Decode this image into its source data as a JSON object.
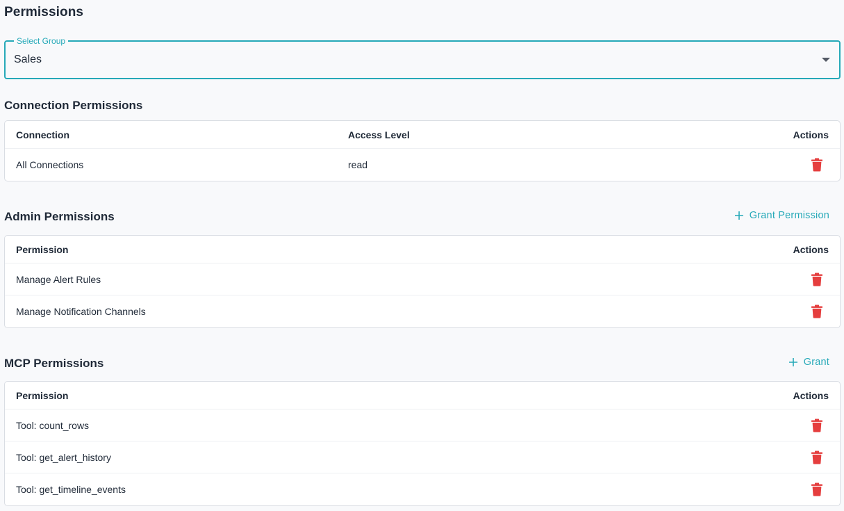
{
  "page": {
    "title": "Permissions"
  },
  "group_select": {
    "legend": "Select Group",
    "value": "Sales"
  },
  "connection_permissions": {
    "title": "Connection Permissions",
    "columns": [
      "Connection",
      "Access Level",
      "Actions"
    ],
    "rows": [
      {
        "connection": "All Connections",
        "access_level": "read"
      }
    ]
  },
  "admin_permissions": {
    "title": "Admin Permissions",
    "grant_label": "Grant Permission",
    "columns": [
      "Permission",
      "Actions"
    ],
    "rows": [
      {
        "permission": "Manage Alert Rules"
      },
      {
        "permission": "Manage Notification Channels"
      }
    ]
  },
  "mcp_permissions": {
    "title": "MCP Permissions",
    "grant_label": "Grant",
    "columns": [
      "Permission",
      "Actions"
    ],
    "rows": [
      {
        "permission": "Tool: count_rows"
      },
      {
        "permission": "Tool: get_alert_history"
      },
      {
        "permission": "Tool: get_timeline_events"
      }
    ]
  },
  "colors": {
    "accent": "#26a9b8",
    "danger": "#e53e3e",
    "text": "#1f2937",
    "border": "#d9dde3"
  },
  "icons": {
    "delete": "trash-icon",
    "add": "plus-icon",
    "dropdown": "caret-down-icon"
  }
}
